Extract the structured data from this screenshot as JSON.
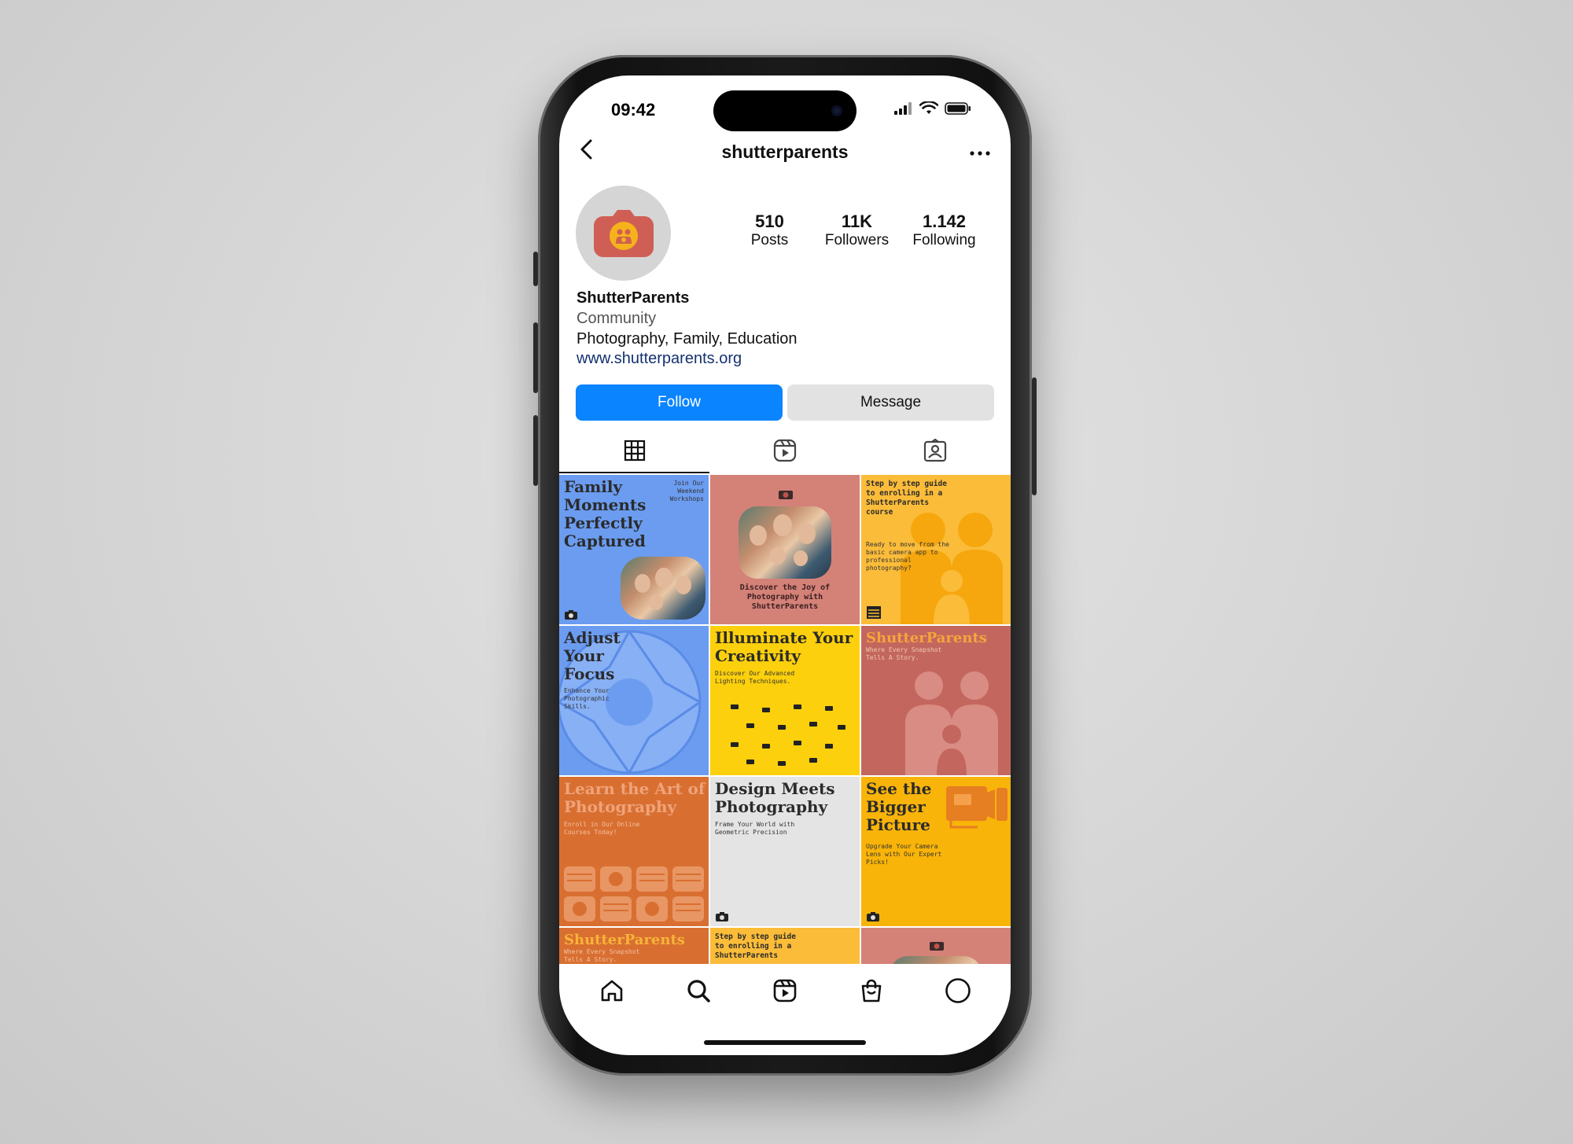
{
  "status": {
    "time": "09:42"
  },
  "header": {
    "username": "shutterparents"
  },
  "profile": {
    "posts_count": "510",
    "posts_label": "Posts",
    "followers_count": "11K",
    "followers_label": "Followers",
    "following_count": "1.142",
    "following_label": "Following",
    "name": "ShutterParents",
    "category": "Community",
    "description": "Photography, Family, Education",
    "link": "www.shutterparents.org"
  },
  "actions": {
    "follow_label": "Follow",
    "message_label": "Message"
  },
  "tabs": [
    {
      "name": "grid",
      "icon": "grid-icon",
      "active": true
    },
    {
      "name": "reels",
      "icon": "reels-icon",
      "active": false
    },
    {
      "name": "tagged",
      "icon": "tagged-icon",
      "active": false
    }
  ],
  "posts": [
    {
      "title": "Family Moments Perfectly Captured",
      "sub": "Join Our Weekend Workshops",
      "bg": "#6b9cf0"
    },
    {
      "caption": "Discover the Joy of Photography with ShutterParents",
      "bg": "#d48178"
    },
    {
      "title": "Step by step guide to enrolling in a ShutterParents course",
      "sub": "Ready to move from the basic camera app to professional photography?",
      "bg": "#fbbc3a"
    },
    {
      "title": "Adjust Your Focus",
      "sub": "Enhance Your Photographic Skills.",
      "bg": "#6b9cf0"
    },
    {
      "title": "Illuminate Your Creativity",
      "sub": "Discover Our Advanced Lighting Techniques.",
      "bg": "#fcd00c"
    },
    {
      "title": "ShutterParents",
      "sub": "Where Every Snapshot Tells A Story.",
      "bg": "#c3675e"
    },
    {
      "title": "Learn the Art of Photography",
      "sub": "Enroll in Our Online Courses Today!",
      "bg": "#d86f31"
    },
    {
      "title": "Design Meets Photography",
      "sub": "Frame Your World with Geometric Precision",
      "bg": "#e4e4e4"
    },
    {
      "title": "See the Bigger Picture",
      "sub": "Upgrade Your Camera Lens with Our Expert Picks!",
      "bg": "#f9b409"
    },
    {
      "title": "ShutterParents",
      "sub": "Where Every Snapshot Tells A Story.",
      "bg": "#d86f31"
    },
    {
      "title": "Step by step guide to enrolling in a ShutterParents",
      "bg": "#fbbc3a"
    },
    {
      "bg": "#d48178"
    }
  ],
  "nav": [
    {
      "icon": "home-icon"
    },
    {
      "icon": "search-icon"
    },
    {
      "icon": "reels-icon"
    },
    {
      "icon": "shop-icon"
    },
    {
      "icon": "profile-icon"
    }
  ],
  "colors": {
    "accent": "#0a84ff",
    "link": "#15316f",
    "avatar_camera": "#cf5f54",
    "avatar_badge": "#f6b21b"
  }
}
